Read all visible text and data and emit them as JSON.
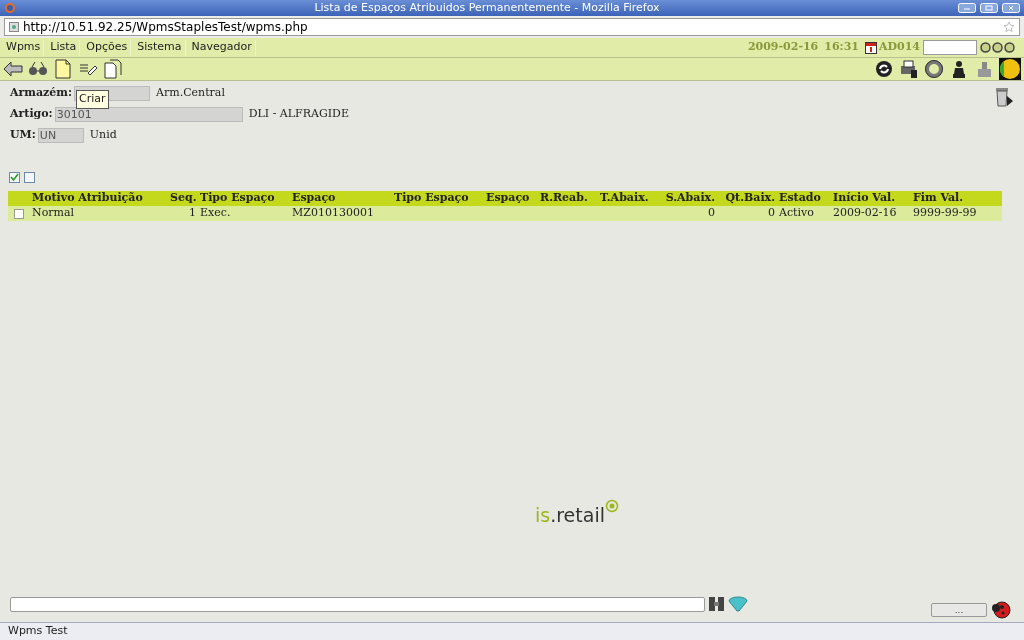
{
  "window": {
    "title": "Lista de Espaços Atribuidos Permanentemente - Mozilla Firefox"
  },
  "address_bar": {
    "url": "http://10.51.92.25/WpmsStaplesTest/wpms.php"
  },
  "menu": [
    "Wpms",
    "Lista",
    "Opções",
    "Sistema",
    "Navegador"
  ],
  "session": {
    "date": "2009-02-16",
    "time": "16:31",
    "user": "AD014"
  },
  "tooltip": "Criar",
  "form": [
    {
      "label": "Armazém:",
      "description": "Arm.Central"
    },
    {
      "label": "Artigo:",
      "value": "30101",
      "description": "DLI - ALFRAGIDE"
    },
    {
      "label": "UM:",
      "value": "UN",
      "description": "Unid"
    }
  ],
  "toggles": [
    {
      "checked": true
    },
    {
      "checked": false
    }
  ],
  "table": {
    "columns": [
      "Motivo Atribuição",
      "Seq.",
      "Tipo Espaço",
      "Espaço",
      "Tipo Espaço",
      "Espaço",
      "R.Reab.",
      "T.Abaix.",
      "S.Abaix.",
      "Qt.Baix.",
      "Estado",
      "Início Val.",
      "Fim Val."
    ],
    "rows": [
      {
        "selected": false,
        "cells": [
          "Normal",
          "1",
          "Exec.",
          "MZ010130001",
          "",
          "",
          "",
          "",
          "0",
          "0",
          "Activo",
          "2009-02-16",
          "9999-99-99"
        ]
      }
    ]
  },
  "logo": {
    "prefix": "is",
    "suffix": ".retail"
  },
  "more_button": "...",
  "status_bar": "Wpms Test"
}
